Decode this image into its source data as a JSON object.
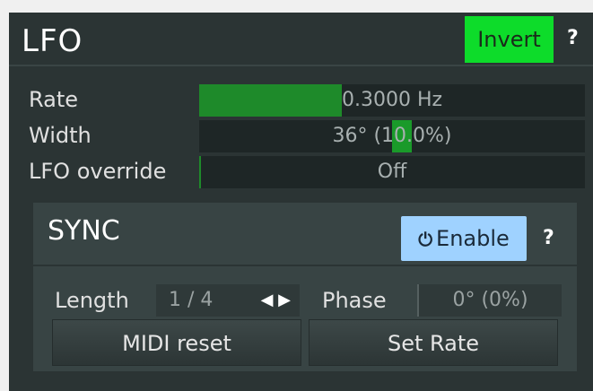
{
  "lfo": {
    "title": "LFO",
    "invert_label": "Invert",
    "help_label": "?",
    "params": {
      "rate": {
        "label": "Rate",
        "value_text": "0.3000 Hz",
        "fill_fraction": 0.37
      },
      "width": {
        "label": "Width",
        "value_text": "36° (10.0%)",
        "fill_fraction": 0.1
      },
      "override": {
        "label": "LFO override",
        "value_text": "Off",
        "fill_fraction": 0.0
      }
    }
  },
  "sync": {
    "title": "SYNC",
    "enable_label": "Enable",
    "help_label": "?",
    "length": {
      "label": "Length",
      "value_text": "1 / 4",
      "arrows": "◀ ▶"
    },
    "phase": {
      "label": "Phase",
      "value_text": "0° (0%)"
    },
    "midi_reset_label": "MIDI reset",
    "set_rate_label": "Set Rate"
  },
  "colors": {
    "panel": "#2b3434",
    "invert_active": "#0ddc2a",
    "enable_active": "#9fd2ff",
    "slider_fill": "#1e8a2a"
  }
}
